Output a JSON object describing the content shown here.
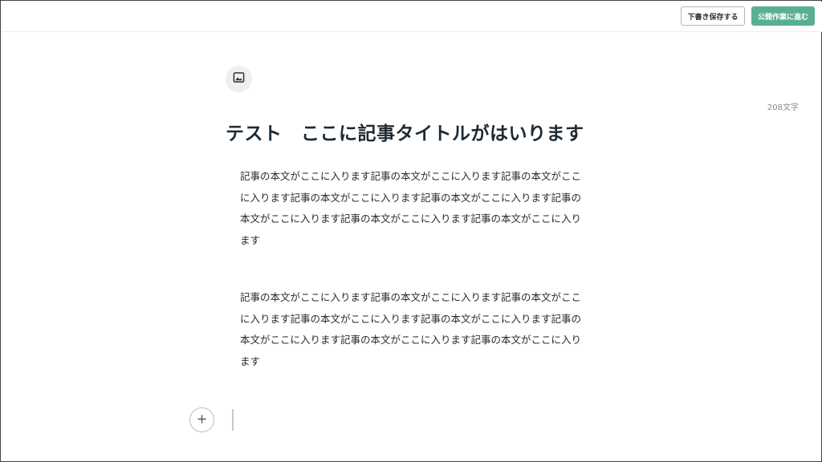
{
  "header": {
    "save_draft_label": "下書き保存する",
    "publish_label": "公開作業に進む"
  },
  "editor": {
    "char_count": "208文字",
    "title": "テスト　ここに記事タイトルがはいります",
    "paragraphs": [
      "記事の本文がここに入ります記事の本文がここに入ります記事の本文がここに入ります記事の本文がここに入ります記事の本文がここに入ります記事の本文がここに入ります記事の本文がここに入ります記事の本文がここに入ります",
      "記事の本文がここに入ります記事の本文がここに入ります記事の本文がここに入ります記事の本文がここに入ります記事の本文がここに入ります記事の本文がここに入ります記事の本文がここに入ります記事の本文がここに入ります"
    ]
  },
  "icons": {
    "image_button": "image-icon",
    "add_button": "plus-icon"
  },
  "colors": {
    "publish_button": "#5aaf93",
    "title_text": "#1d2a33",
    "muted_text": "#8b8b8b"
  }
}
